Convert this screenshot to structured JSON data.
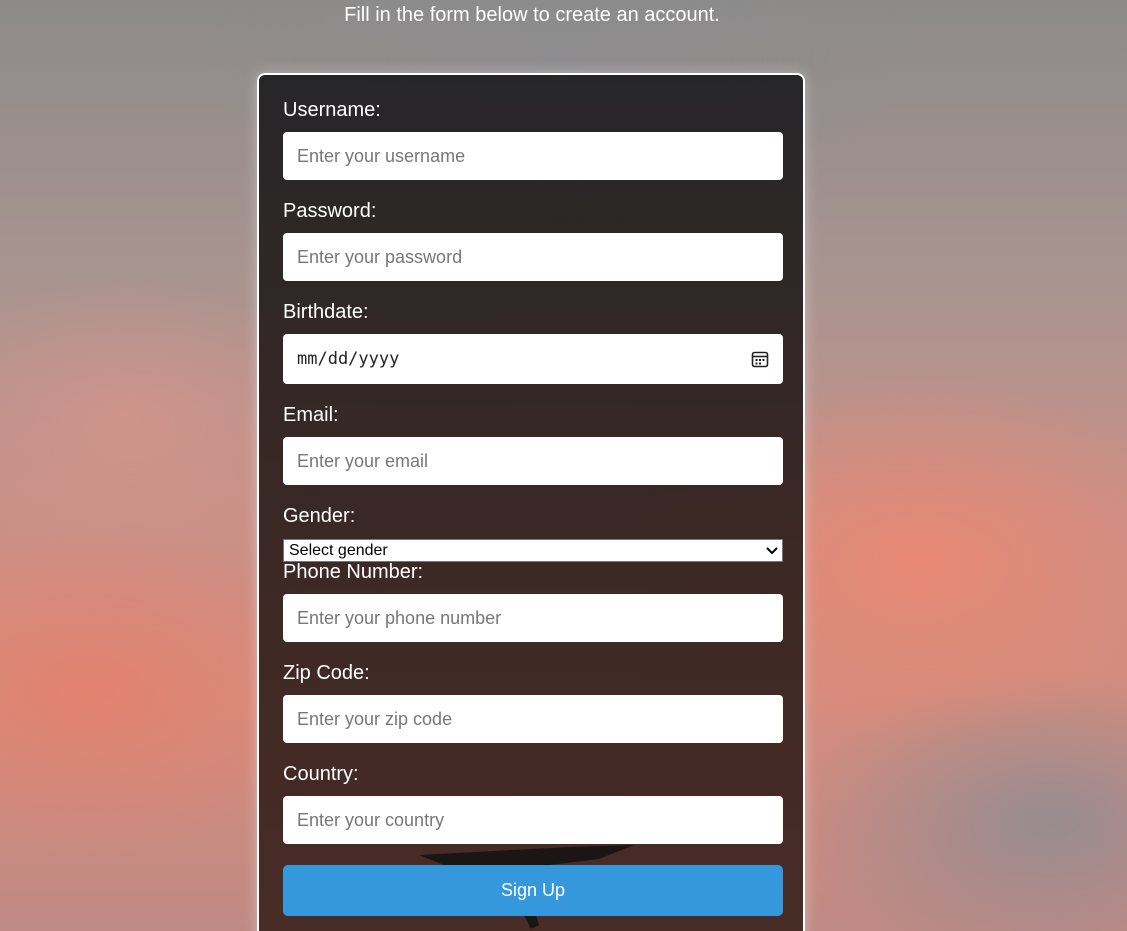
{
  "header": {
    "subtitle": "Fill in the form below to create an account."
  },
  "form": {
    "username": {
      "label": "Username:",
      "placeholder": "Enter your username"
    },
    "password": {
      "label": "Password:",
      "placeholder": "Enter your password"
    },
    "birthdate": {
      "label": "Birthdate:",
      "placeholder": "mm/dd/yyyy",
      "icon": "calendar-icon"
    },
    "email": {
      "label": "Email:",
      "placeholder": "Enter your email"
    },
    "gender": {
      "label": "Gender:",
      "selected": "Select gender",
      "icon": "chevron-down-icon"
    },
    "phone": {
      "label": "Phone Number:",
      "placeholder": "Enter your phone number"
    },
    "zip": {
      "label": "Zip Code:",
      "placeholder": "Enter your zip code"
    },
    "country": {
      "label": "Country:",
      "placeholder": "Enter your country"
    },
    "submit_label": "Sign Up"
  },
  "colors": {
    "button": "#3598dc",
    "card_border": "#ffffff",
    "label_text": "#ffffff"
  }
}
